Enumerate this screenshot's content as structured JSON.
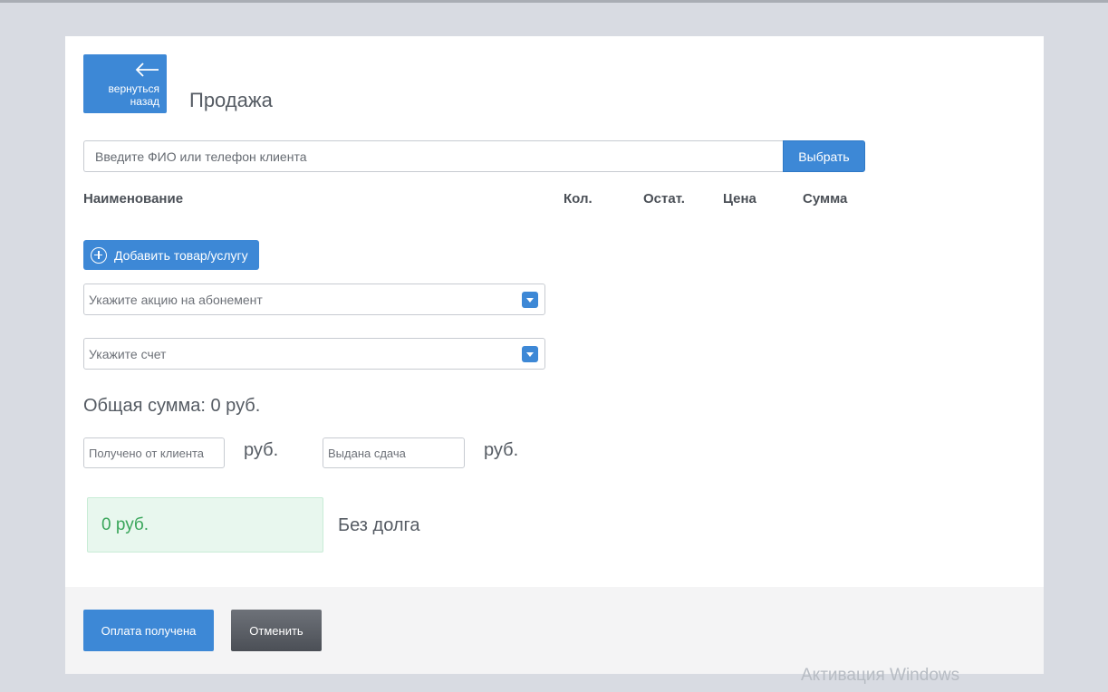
{
  "header": {
    "back_label": "вернуться\nназад",
    "title": "Продажа"
  },
  "client": {
    "placeholder": "Введите ФИО или телефон клиента",
    "select_label": "Выбрать"
  },
  "table": {
    "columns": [
      "Наименование",
      "Кол.",
      "Остат.",
      "Цена",
      "Сумма"
    ]
  },
  "add_item_label": "Добавить товар/услугу",
  "promo_select": {
    "placeholder": "Укажите акцию на абонемент"
  },
  "account_select": {
    "placeholder": "Укажите счет"
  },
  "total": "Общая сумма: 0 руб.",
  "payment": {
    "received_placeholder": "Получено от клиента",
    "change_placeholder": "Выдана сдача",
    "currency": "руб."
  },
  "debt": {
    "amount": "0 руб.",
    "status": "Без долга"
  },
  "footer": {
    "pay_label": "Оплата получена",
    "cancel_label": "Отменить"
  },
  "watermark": "Активация Windows",
  "colors": {
    "primary": "#3d88d6",
    "success_bg": "#e8f7ee",
    "success_text": "#3aa65b"
  }
}
